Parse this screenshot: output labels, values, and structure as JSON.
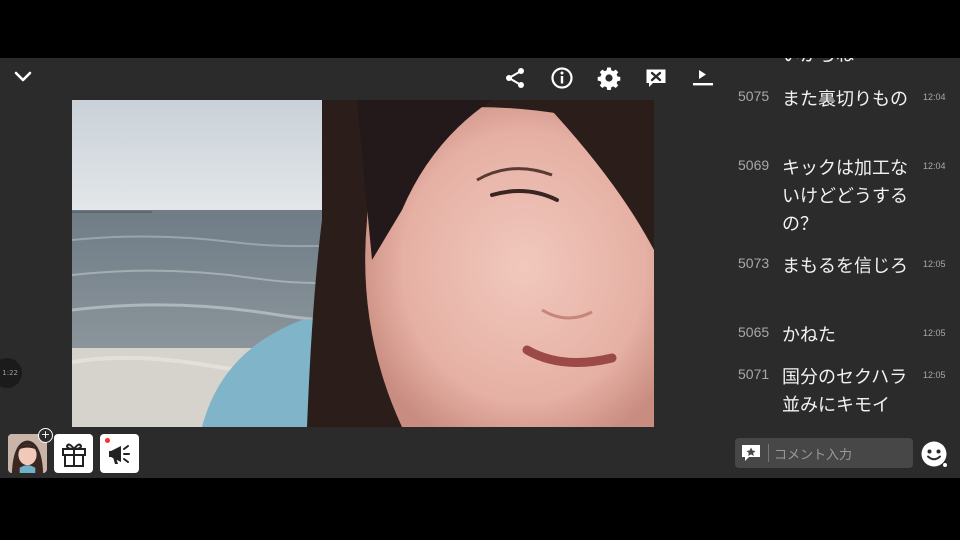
{
  "toolbar": {
    "icons": [
      "chevron-down-icon",
      "share-icon",
      "info-icon",
      "gear-icon",
      "comment-off-icon",
      "layout-toggle-icon"
    ]
  },
  "player": {
    "timer": "1:22"
  },
  "bottom_actions": [
    "avatar-follow",
    "gift-icon",
    "megaphone-icon"
  ],
  "comments": [
    {
      "num": "",
      "text": "いからね",
      "time": ""
    },
    {
      "num": "5075",
      "text": "また裏切りもの",
      "time": "12:04"
    },
    {
      "num": "5069",
      "text": "キックは加工ないけどどうするの？",
      "time": "12:04"
    },
    {
      "num": "5073",
      "text": "まもるを信じろ",
      "time": "12:05"
    },
    {
      "num": "5065",
      "text": "かねた",
      "time": "12:05"
    },
    {
      "num": "5071",
      "text": "国分のセクハラ並みにキモイ",
      "time": "12:05"
    }
  ],
  "comment_input": {
    "placeholder": "コメント入力"
  },
  "colors": {
    "panel": "#2b2b2b",
    "letterbox": "#000000",
    "input_bg": "#474747"
  }
}
